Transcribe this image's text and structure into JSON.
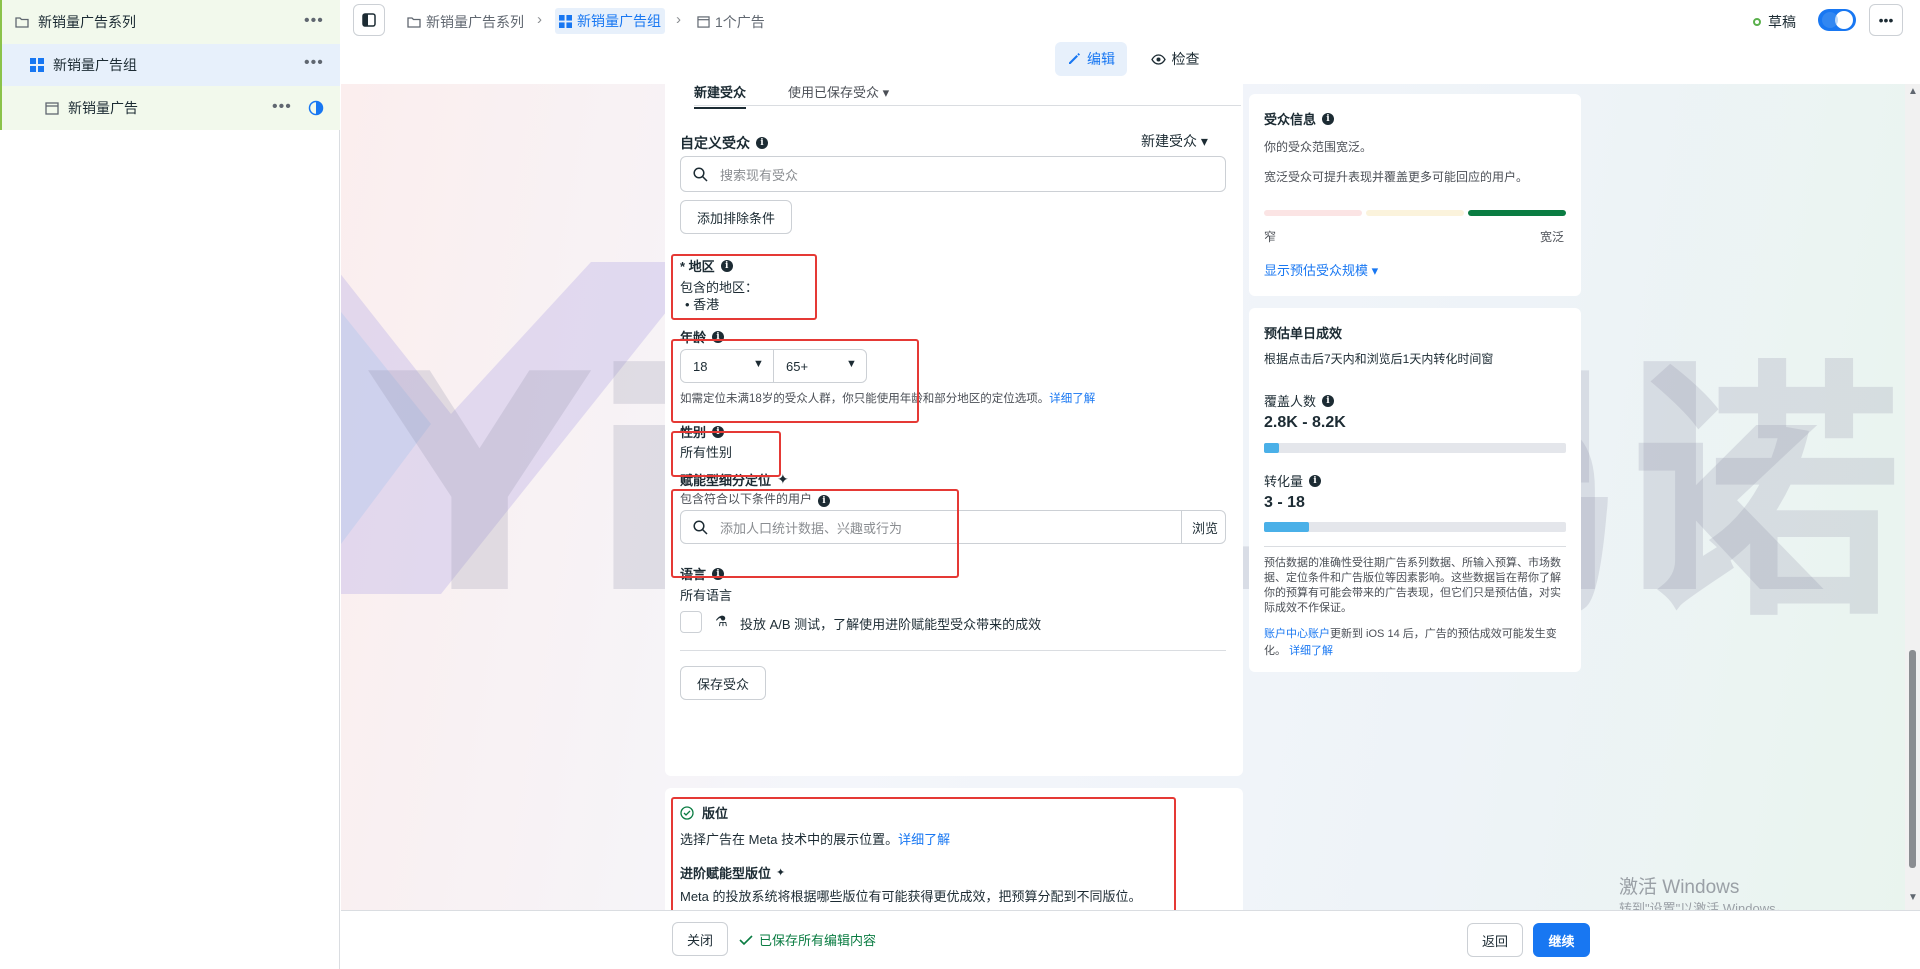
{
  "tree": {
    "campaign": {
      "label": "新销量广告系列",
      "more": "•••"
    },
    "adset": {
      "label": "新销量广告组",
      "more": "•••"
    },
    "ad": {
      "label": "新销量广告",
      "more": "•••"
    }
  },
  "breadcrumb": {
    "campaign": "新销量广告系列",
    "adset": "新销量广告组",
    "ad": "1个广告"
  },
  "status": {
    "label": "草稿",
    "more": "•••"
  },
  "modes": {
    "edit": "编辑",
    "review": "检查"
  },
  "audience": {
    "tabs": {
      "new": "新建受众",
      "saved": "使用已保存受众"
    },
    "custom": {
      "label": "自定义受众",
      "new_label": "新建受众",
      "search_placeholder": "搜索现有受众",
      "exclude_btn": "添加排除条件"
    },
    "location": {
      "label": "* 地区",
      "included": "包含的地区：",
      "item": "香港"
    },
    "age": {
      "label": "年龄",
      "min": "18",
      "max": "65+",
      "note": "如需定位未满18岁的受众人群，你只能使用年龄和部分地区的定位选项。",
      "note_link": "详细了解"
    },
    "gender": {
      "label": "性别",
      "value": "所有性别"
    },
    "detailed": {
      "label": "赋能型细分定位",
      "sub": "包含符合以下条件的用户",
      "placeholder": "添加人口统计数据、兴趣或行为",
      "browse": "浏览"
    },
    "language": {
      "label": "语言",
      "value": "所有语言"
    },
    "ab_test": "投放 A/B 测试，了解使用进阶赋能型受众带来的成效",
    "save_btn": "保存受众"
  },
  "placements": {
    "title": "版位",
    "desc": "选择广告在 Meta 技术中的展示位置。",
    "desc_link": "详细了解",
    "adv_title": "进阶赋能型版位",
    "adv_desc": "Meta 的投放系统将根据哪些版位有可能获得更优成效，把预算分配到不同版位。"
  },
  "audience_info": {
    "title": "受众信息",
    "line1": "你的受众范围宽泛。",
    "line2": "宽泛受众可提升表现并覆盖更多可能回应的用户。",
    "narrow": "窄",
    "broad": "宽泛",
    "show_size": "显示预估受众规模"
  },
  "estimate": {
    "title": "预估单日成效",
    "subtitle": "根据点击后7天内和浏览后1天内转化时间窗",
    "reach_label": "覆盖人数",
    "reach_value": "2.8K - 8.2K",
    "reach_fill": 0.05,
    "conv_label": "转化量",
    "conv_value": "3 - 18",
    "conv_fill": 0.15,
    "disclaimer": "预估数据的准确性受往期广告系列数据、所输入预算、市场数据、定位条件和广告版位等因素影响。这些数据旨在帮你了解你的预算有可能会带来的广告表现，但它们只是预估值，对实际成效不作保证。",
    "ios_link": "账户中心账户",
    "ios_note": "更新到 iOS 14 后，广告的预估成效可能发生变化。",
    "ios_more": "详细了解"
  },
  "bottom": {
    "close": "关闭",
    "saved": "已保存所有编辑内容",
    "back": "返回",
    "continue": "继续"
  },
  "watermark": {
    "brand_latin": "YinoLink",
    "brand_cn": "易诺"
  },
  "windows": {
    "line1": "激活 Windows",
    "line2": "转到\"设置\"以激活 Windows。"
  },
  "colors": {
    "accent": "#1877f2",
    "red_box": "#e53935",
    "green": "#0a7c42",
    "continue_bg": "#1877f2"
  }
}
